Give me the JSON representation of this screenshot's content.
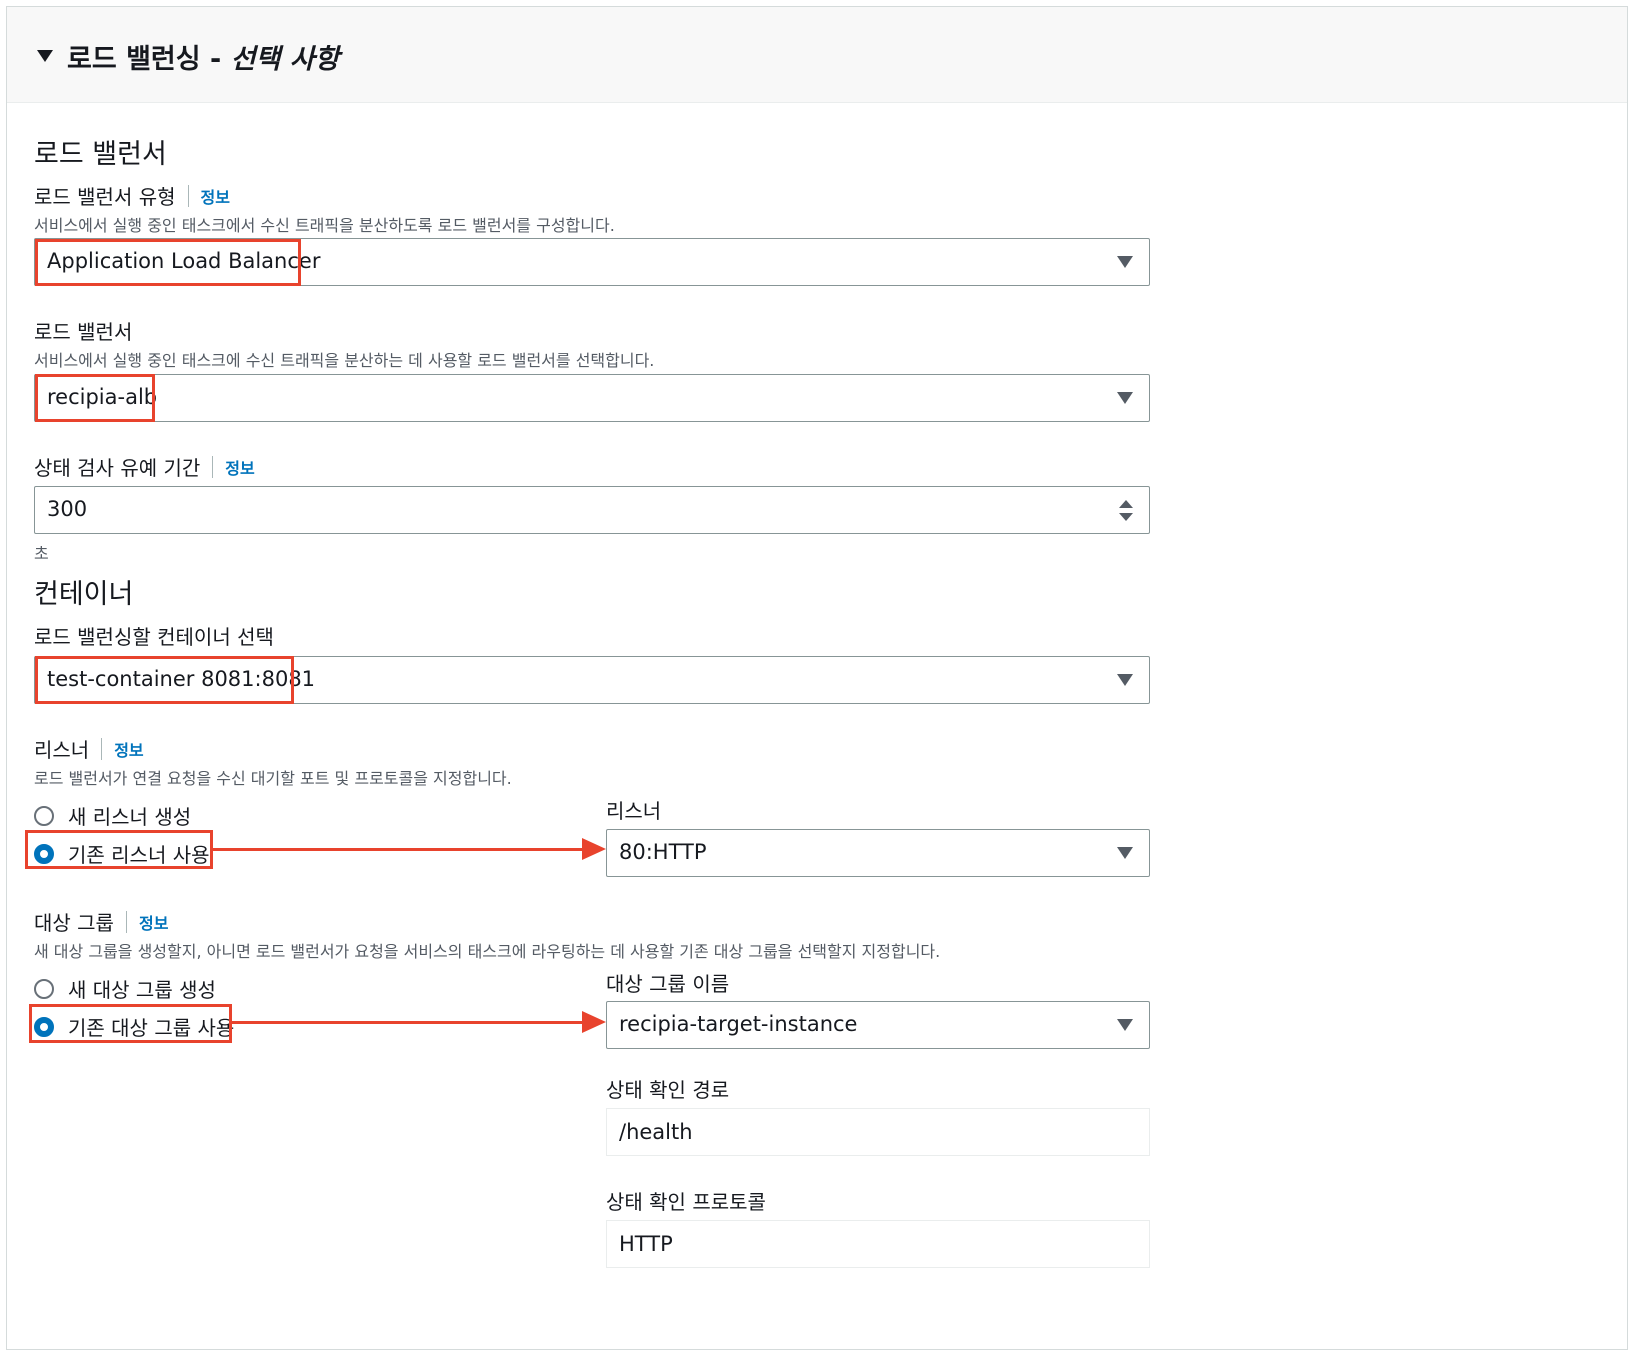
{
  "header": {
    "title_main": "로드 밸런싱 - ",
    "title_optional": "선택 사항"
  },
  "load_balancer_section": {
    "heading": "로드 밸런서",
    "type_label": "로드 밸런서 유형",
    "type_info": "정보",
    "type_desc": "서비스에서 실행 중인 태스크에서 수신 트래픽을 분산하도록 로드 밸런서를 구성합니다.",
    "type_value": "Application Load Balancer",
    "lb_label": "로드 밸런서",
    "lb_desc": "서비스에서 실행 중인 태스크에 수신 트래픽을 분산하는 데 사용할 로드 밸런서를 선택합니다.",
    "lb_value": "recipia-alb",
    "grace_label": "상태 검사 유예 기간",
    "grace_info": "정보",
    "grace_value": "300",
    "grace_unit": "초"
  },
  "container_section": {
    "heading": "컨테이너",
    "select_label": "로드 밸런싱할 컨테이너 선택",
    "select_value": "test-container 8081:8081"
  },
  "listener_section": {
    "label": "리스너",
    "info": "정보",
    "desc": "로드 밸런서가 연결 요청을 수신 대기할 포트 및 프로토콜을 지정합니다.",
    "option_new": "새 리스너 생성",
    "option_existing": "기존 리스너 사용",
    "selected": "existing",
    "listener_label": "리스너",
    "listener_value": "80:HTTP"
  },
  "target_group_section": {
    "label": "대상 그룹",
    "info": "정보",
    "desc": "새 대상 그룹을 생성할지, 아니면 로드 밸런서가 요청을 서비스의 태스크에 라우팅하는 데 사용할 기존 대상 그룹을 선택할지 지정합니다.",
    "option_new": "새 대상 그룹 생성",
    "option_existing": "기존 대상 그룹 사용",
    "selected": "existing",
    "name_label": "대상 그룹 이름",
    "name_value": "recipia-target-instance",
    "health_path_label": "상태 확인 경로",
    "health_path_value": "/health",
    "health_protocol_label": "상태 확인 프로토콜",
    "health_protocol_value": "HTTP"
  },
  "colors": {
    "highlight": "#e8432d",
    "link": "#0073bb",
    "radio_selected": "#0073bb"
  }
}
